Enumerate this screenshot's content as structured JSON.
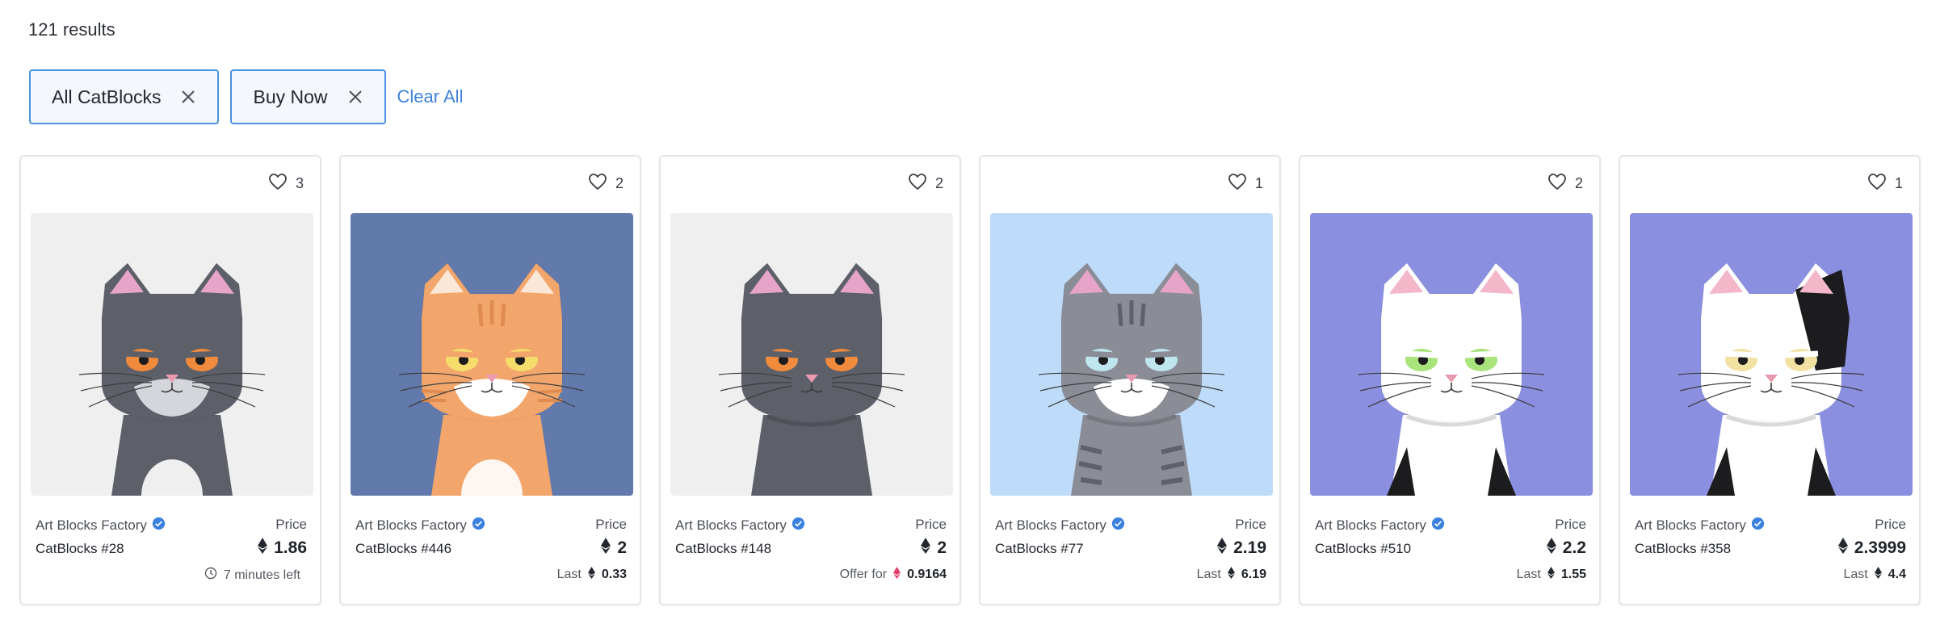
{
  "results_label": "121 results",
  "filters": {
    "chips": [
      {
        "label": "All CatBlocks"
      },
      {
        "label": "Buy Now"
      }
    ],
    "clear_all": "Clear All"
  },
  "price_label": "Price",
  "cards": [
    {
      "collection": "Art Blocks Factory",
      "name": "CatBlocks #28",
      "likes": "3",
      "price": "1.86",
      "footer_label": "7 minutes left",
      "footer_value": "",
      "footer_icon": "clock-icon",
      "colors": {
        "bg": "#efefef",
        "fur": "#5d6069",
        "face": "#5d6069",
        "chest": "#d4d6dc",
        "eye": "#f08a3c",
        "ear": "#e6a5c8"
      }
    },
    {
      "collection": "Art Blocks Factory",
      "name": "CatBlocks #446",
      "likes": "2",
      "price": "2",
      "footer_label": "Last",
      "footer_value": "0.33",
      "footer_icon": "eth-icon",
      "colors": {
        "bg": "#6279ab",
        "fur": "#f2a66c",
        "face": "#f2a66c",
        "chest": "#ffffff",
        "eye": "#f6dd6b",
        "ear": "#fbe7d7"
      }
    },
    {
      "collection": "Art Blocks Factory",
      "name": "CatBlocks #148",
      "likes": "2",
      "price": "2",
      "footer_label": "Offer for",
      "footer_value": "0.9164",
      "footer_icon": "weth-icon",
      "colors": {
        "bg": "#efefef",
        "fur": "#5d6069",
        "face": "#5d6069",
        "chest": "#5d6069",
        "eye": "#f08a3c",
        "ear": "#e6a5c8"
      }
    },
    {
      "collection": "Art Blocks Factory",
      "name": "CatBlocks #77",
      "likes": "1",
      "price": "2.19",
      "footer_label": "Last",
      "footer_value": "6.19",
      "footer_icon": "eth-icon",
      "colors": {
        "bg": "#bedcfa",
        "fur": "#8a8d96",
        "face": "#8a8d96",
        "chest": "#ffffff",
        "eye": "#bfe6ee",
        "ear": "#e6a5c8"
      }
    },
    {
      "collection": "Art Blocks Factory",
      "name": "CatBlocks #510",
      "likes": "2",
      "price": "2.2",
      "footer_label": "Last",
      "footer_value": "1.55",
      "footer_icon": "eth-icon",
      "colors": {
        "bg": "#8a8fe0",
        "fur": "#ffffff",
        "face": "#ffffff",
        "chest": "#ffffff",
        "eye": "#a9e37b",
        "ear": "#f4b6c9"
      }
    },
    {
      "collection": "Art Blocks Factory",
      "name": "CatBlocks #358",
      "likes": "1",
      "price": "2.3999",
      "footer_label": "Last",
      "footer_value": "4.4",
      "footer_icon": "eth-icon",
      "colors": {
        "bg": "#8a8fe0",
        "fur": "#ffffff",
        "face": "#ffffff",
        "chest": "#ffffff",
        "eye": "#f1e2a3",
        "ear": "#f4b6c9"
      }
    }
  ]
}
